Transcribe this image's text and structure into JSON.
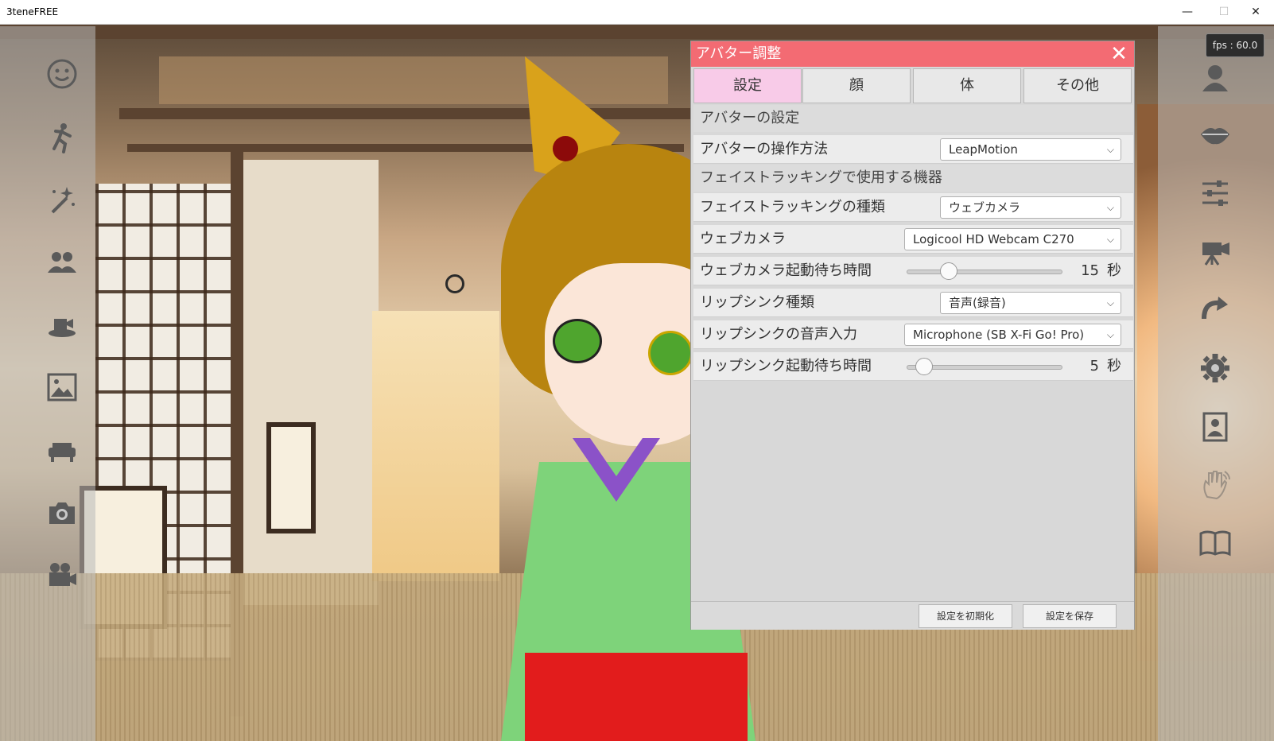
{
  "window": {
    "title": "3teneFREE",
    "minimize_glyph": "—",
    "maximize_glyph": "☐",
    "close_glyph": "✕"
  },
  "fps": "fps : 60.0",
  "left_toolbar": [
    {
      "name": "face-expression-icon"
    },
    {
      "name": "pose-icon"
    },
    {
      "name": "effect-wand-icon"
    },
    {
      "name": "group-icon"
    },
    {
      "name": "stage-object-icon"
    },
    {
      "name": "background-image-icon"
    },
    {
      "name": "furniture-icon"
    },
    {
      "name": "camera-icon"
    },
    {
      "name": "video-camera-icon"
    }
  ],
  "right_toolbar": [
    {
      "name": "avatar-bust-icon"
    },
    {
      "name": "lips-icon"
    },
    {
      "name": "sliders-icon"
    },
    {
      "name": "movie-camera-icon"
    },
    {
      "name": "rotate-arrow-icon"
    },
    {
      "name": "settings-gear-icon"
    },
    {
      "name": "portrait-frame-icon"
    },
    {
      "name": "wave-hand-icon"
    },
    {
      "name": "manual-book-icon"
    }
  ],
  "dialog": {
    "title": "アバター調整",
    "close": "✕",
    "tabs": [
      {
        "label": "設定",
        "active": true
      },
      {
        "label": "顔",
        "active": false
      },
      {
        "label": "体",
        "active": false
      },
      {
        "label": "その他",
        "active": false
      }
    ],
    "section_avatar": "アバターの設定",
    "control_method_label": "アバターの操作方法",
    "control_method_value": "LeapMotion",
    "section_face_device": "フェイストラッキングで使用する機器",
    "face_type_label": "フェイストラッキングの種類",
    "face_type_value": "ウェブカメラ",
    "webcam_label": "ウェブカメラ",
    "webcam_value": "Logicool HD Webcam C270",
    "webcam_wait_label": "ウェブカメラ起動待ち時間",
    "webcam_wait_value": "15",
    "webcam_wait_max": 60,
    "webcam_wait_unit": "秒",
    "lipsync_type_label": "リップシンク種類",
    "lipsync_type_value": "音声(録音)",
    "lipsync_input_label": "リップシンクの音声入力",
    "lipsync_input_value": "Microphone (SB X-Fi Go! Pro)",
    "lipsync_wait_label": "リップシンク起動待ち時間",
    "lipsync_wait_value": "5",
    "lipsync_wait_max": 60,
    "lipsync_wait_unit": "秒",
    "reset_button": "設定を初期化",
    "save_button": "設定を保存",
    "chevron": "⌵"
  },
  "colors": {
    "dialog_title_bar": "#f36b73",
    "active_tab": "#f8cbe8"
  }
}
